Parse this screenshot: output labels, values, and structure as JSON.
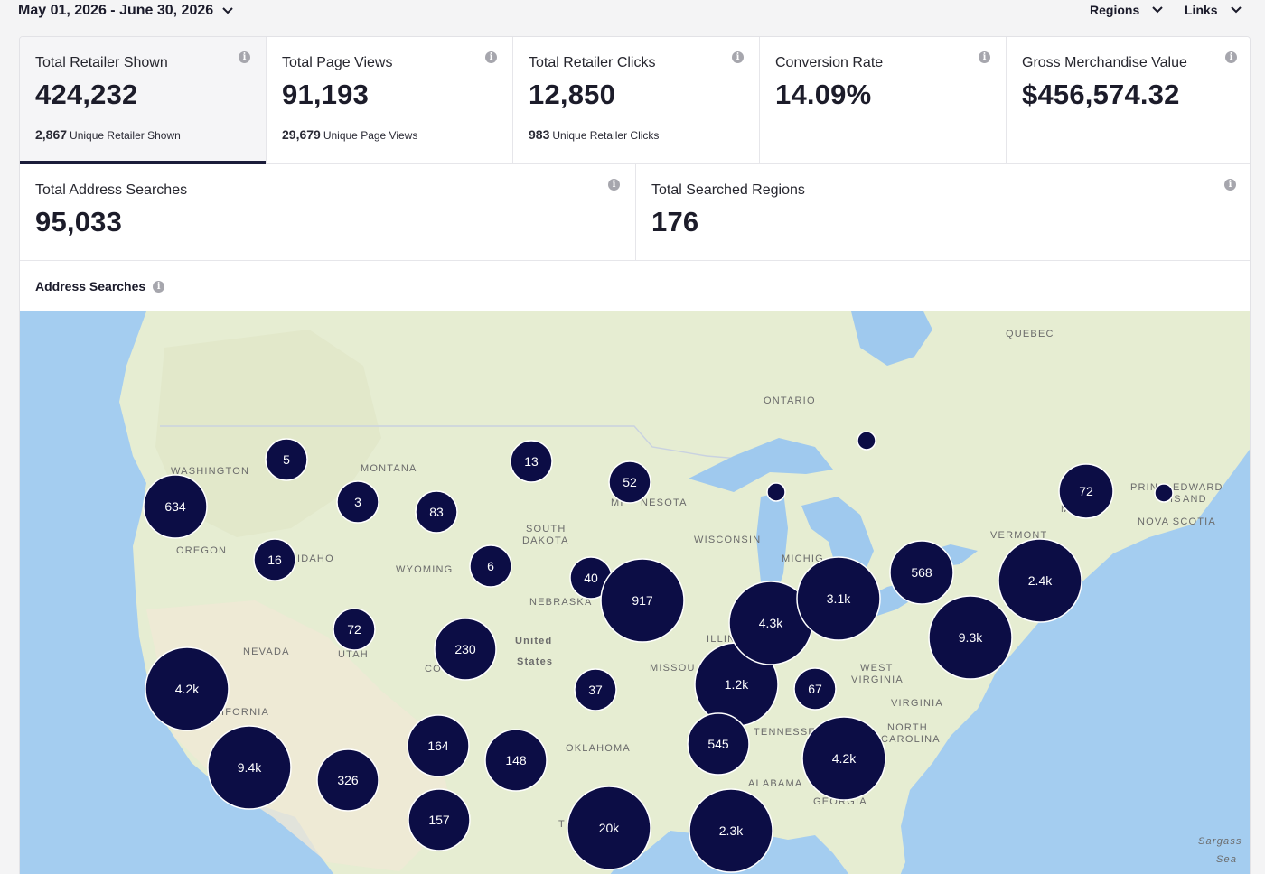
{
  "header": {
    "date_range": "May 01, 2026 - June 30, 2026",
    "regions_label": "Regions",
    "links_label": "Links"
  },
  "metrics": [
    {
      "label": "Total Retailer Shown",
      "value": "424,232",
      "sub_value": "2,867",
      "sub_label": "Unique Retailer Shown"
    },
    {
      "label": "Total Page Views",
      "value": "91,193",
      "sub_value": "29,679",
      "sub_label": "Unique Page Views"
    },
    {
      "label": "Total Retailer Clicks",
      "value": "12,850",
      "sub_value": "983",
      "sub_label": "Unique Retailer Clicks"
    },
    {
      "label": "Conversion Rate",
      "value": "14.09%"
    },
    {
      "label": "Gross Merchandise Value",
      "value": "$456,574.32"
    },
    {
      "label": "Total Address Searches",
      "value": "95,033"
    },
    {
      "label": "Total Searched Regions",
      "value": "176"
    }
  ],
  "info_glyph": "i",
  "map": {
    "title": "Address Searches",
    "region_labels": [
      "WASHINGTON",
      "OREGON",
      "MONTANA",
      "IDAHO",
      "WYOMING",
      "NEVADA",
      "UTAH",
      "CO",
      "IFORNIA",
      "SOUTH",
      "DAKOTA",
      "NEBRASKA",
      "MI",
      "NESOTA",
      "WISCONSIN",
      "ONTARIO",
      "QUEBEC",
      "ILLIN",
      "MISSOU",
      "OKLAHOMA",
      "TENNESSEE",
      "ALABAMA",
      "GEORGIA",
      "MICHIG",
      "WEST",
      "VIRGINIA",
      "VIRGINIA",
      "NORTH",
      "CAROLINA",
      "VERMONT",
      "MA",
      "PRIN",
      "EDWARD",
      "IS",
      "AND",
      "NOVA SCOTIA",
      "United",
      "States",
      "Sargass",
      "Sea",
      "T"
    ],
    "clusters": [
      "5",
      "634",
      "3",
      "83",
      "13",
      "52",
      "16",
      "6",
      "40",
      "917",
      "72",
      "230",
      "4.2k",
      "37",
      "1.2k",
      "4.3k",
      "3.1k",
      "568",
      "2.4k",
      "9.3k",
      "67",
      "545",
      "4.2k",
      "9.4k",
      "326",
      "164",
      "148",
      "157",
      "20k",
      "2.3k",
      "72",
      "",
      "",
      ""
    ],
    "colors": {
      "cluster": "#0c0d45",
      "land": "#e6edd2",
      "water": "#a4cdf0",
      "lake": "#9fc9ee"
    }
  }
}
